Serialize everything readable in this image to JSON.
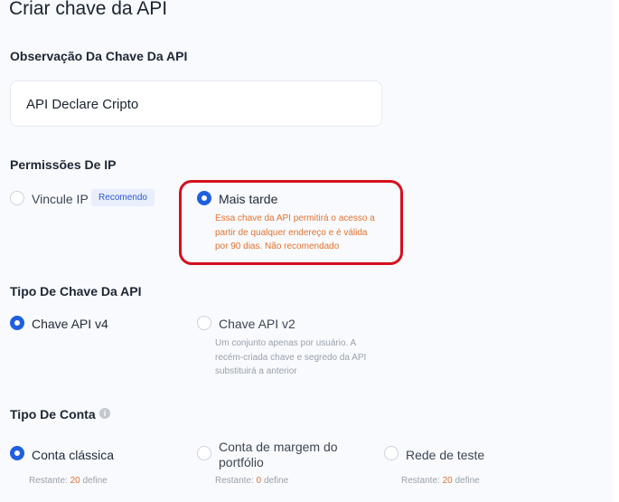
{
  "page": {
    "title": "Criar chave da API"
  },
  "note": {
    "label": "Observação Da Chave Da API",
    "value": "API Declare Cripto"
  },
  "ip_permissions": {
    "label": "Permissões De IP",
    "options": [
      {
        "label": "Vincule IP",
        "badge": "Recomendo",
        "selected": false
      },
      {
        "label": "Mais tarde",
        "selected": true,
        "description": [
          "Essa chave da API permitirá o acesso a",
          "partir de qualquer endereço e é válida",
          "por 90 dias. Não recomendado"
        ]
      }
    ]
  },
  "key_type": {
    "label": "Tipo De Chave Da API",
    "options": [
      {
        "label": "Chave API v4",
        "selected": true
      },
      {
        "label": "Chave API v2",
        "selected": false,
        "description": [
          "Um conjunto apenas por usuário. A",
          "recém-criada chave e segredo da API",
          "substituirá a anterior"
        ]
      }
    ]
  },
  "account_type": {
    "label": "Tipo De Conta",
    "info_icon": "info-icon",
    "remaining_prefix": "Restante:",
    "remaining_suffix": "define",
    "options": [
      {
        "label": "Conta clássica",
        "selected": true,
        "remaining": "20"
      },
      {
        "label_line1": "Conta de margem do",
        "label_line2": "portfólio",
        "selected": false,
        "remaining": "0"
      },
      {
        "label": "Rede de teste",
        "selected": false,
        "remaining": "20"
      }
    ]
  },
  "colors": {
    "accent": "#1f5fe0",
    "warning_text": "#e2732e",
    "highlight_border": "#d5101f",
    "badge_bg": "#e8eefb"
  }
}
